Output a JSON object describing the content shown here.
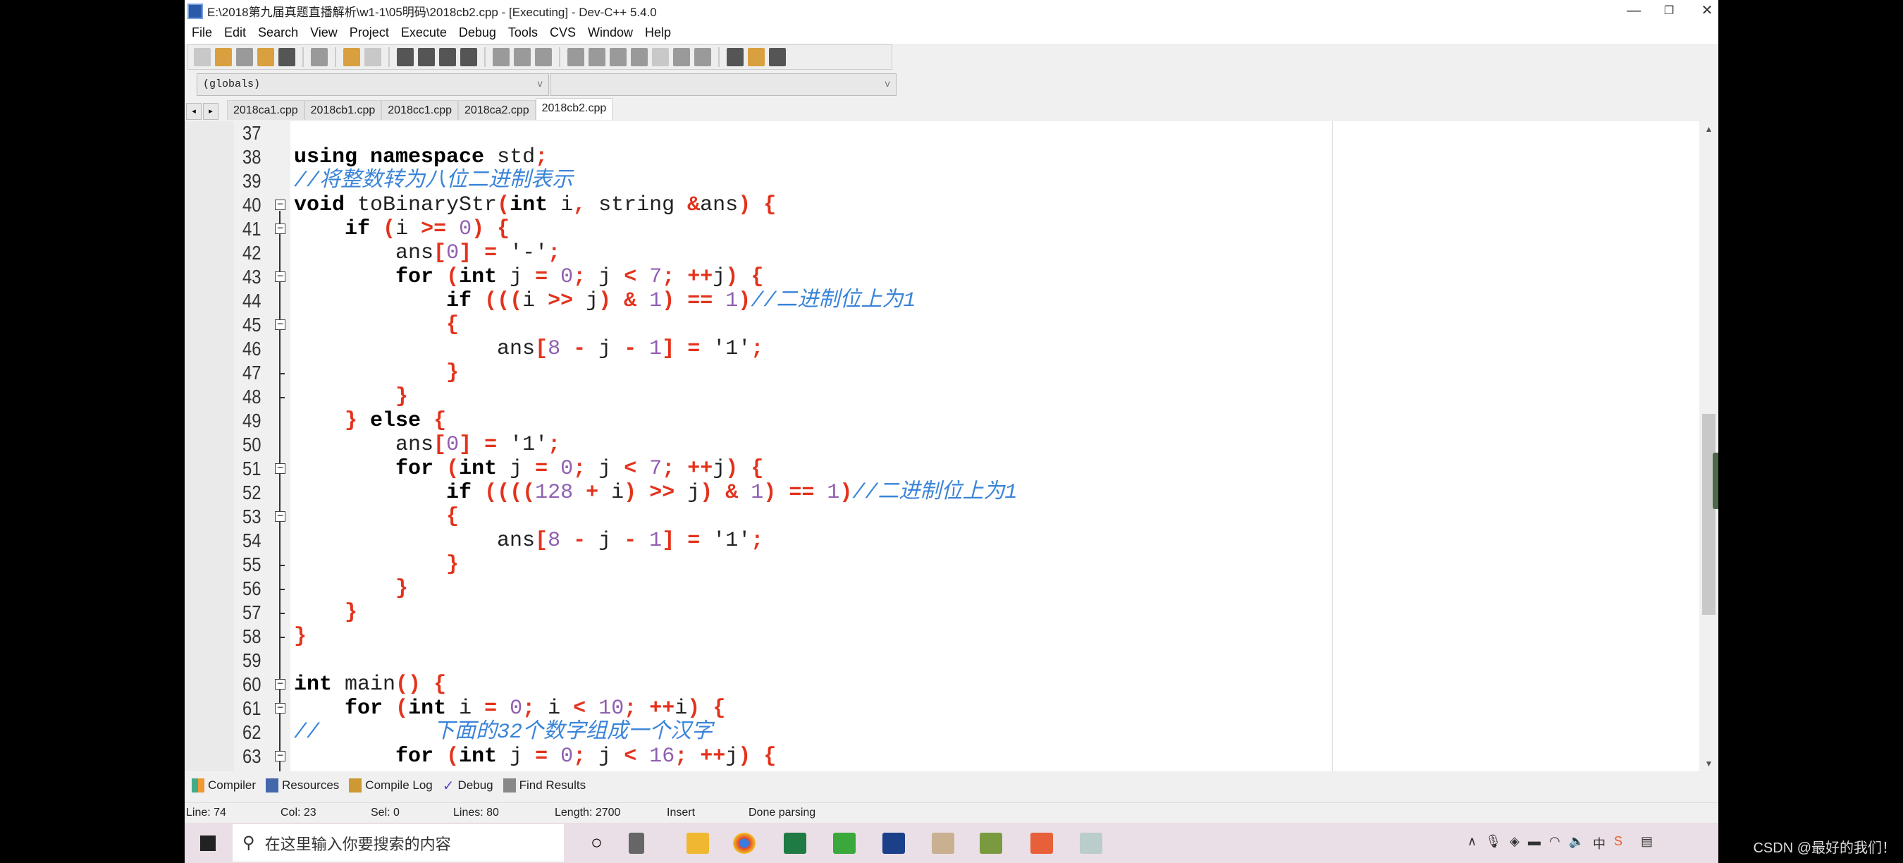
{
  "window": {
    "title": "E:\\2018第九届真题直播解析\\w1-1\\05明码\\2018cb2.cpp - [Executing] - Dev-C++ 5.4.0",
    "minimize": "—",
    "restore": "❐",
    "close": "✕"
  },
  "menu": [
    "File",
    "Edit",
    "Search",
    "View",
    "Project",
    "Execute",
    "Debug",
    "Tools",
    "CVS",
    "Window",
    "Help"
  ],
  "combos": {
    "left": "(globals)",
    "right": "",
    "arrow": "v"
  },
  "tabs": {
    "nav_prev": "◂",
    "nav_next": "▸",
    "items": [
      "2018ca1.cpp",
      "2018cb1.cpp",
      "2018cc1.cpp",
      "2018ca2.cpp",
      "2018cb2.cpp"
    ],
    "active": 4
  },
  "code": [
    {
      "n": "37",
      "fold": "",
      "t": []
    },
    {
      "n": "38",
      "fold": "",
      "t": [
        [
          "k",
          "using"
        ],
        [
          "i",
          " "
        ],
        [
          "k",
          "namespace"
        ],
        [
          "i",
          " std"
        ],
        [
          "s",
          ";"
        ]
      ]
    },
    {
      "n": "39",
      "fold": "",
      "t": [
        [
          "c",
          "//将整数转为八位二进制表示"
        ]
      ]
    },
    {
      "n": "40",
      "fold": "open",
      "t": [
        [
          "k",
          "void"
        ],
        [
          "i",
          " toBinaryStr"
        ],
        [
          "s",
          "("
        ],
        [
          "k",
          "int"
        ],
        [
          "i",
          " i"
        ],
        [
          "s",
          ","
        ],
        [
          "i",
          " string "
        ],
        [
          "s",
          "&"
        ],
        [
          "i",
          "ans"
        ],
        [
          "s",
          ")"
        ],
        [
          "i",
          " "
        ],
        [
          "s",
          "{"
        ]
      ]
    },
    {
      "n": "41",
      "fold": "open",
      "t": [
        [
          "i",
          "    "
        ],
        [
          "k",
          "if"
        ],
        [
          "i",
          " "
        ],
        [
          "s",
          "("
        ],
        [
          "i",
          "i "
        ],
        [
          "s",
          ">="
        ],
        [
          "i",
          " "
        ],
        [
          "n",
          "0"
        ],
        [
          "s",
          ")"
        ],
        [
          "i",
          " "
        ],
        [
          "s",
          "{"
        ]
      ]
    },
    {
      "n": "42",
      "fold": "",
      "t": [
        [
          "i",
          "        ans"
        ],
        [
          "s",
          "["
        ],
        [
          "n",
          "0"
        ],
        [
          "s",
          "]"
        ],
        [
          "i",
          " "
        ],
        [
          "s",
          "="
        ],
        [
          "i",
          " "
        ],
        [
          "t",
          "'-'"
        ],
        [
          "s",
          ";"
        ]
      ]
    },
    {
      "n": "43",
      "fold": "open",
      "t": [
        [
          "i",
          "        "
        ],
        [
          "k",
          "for"
        ],
        [
          "i",
          " "
        ],
        [
          "s",
          "("
        ],
        [
          "k",
          "int"
        ],
        [
          "i",
          " j "
        ],
        [
          "s",
          "="
        ],
        [
          "i",
          " "
        ],
        [
          "n",
          "0"
        ],
        [
          "s",
          ";"
        ],
        [
          "i",
          " j "
        ],
        [
          "s",
          "<"
        ],
        [
          "i",
          " "
        ],
        [
          "n",
          "7"
        ],
        [
          "s",
          ";"
        ],
        [
          "i",
          " "
        ],
        [
          "s",
          "++"
        ],
        [
          "i",
          "j"
        ],
        [
          "s",
          ")"
        ],
        [
          "i",
          " "
        ],
        [
          "s",
          "{"
        ]
      ]
    },
    {
      "n": "44",
      "fold": "",
      "t": [
        [
          "i",
          "            "
        ],
        [
          "k",
          "if"
        ],
        [
          "i",
          " "
        ],
        [
          "s",
          "((("
        ],
        [
          "i",
          "i "
        ],
        [
          "s",
          ">>"
        ],
        [
          "i",
          " j"
        ],
        [
          "s",
          ")"
        ],
        [
          "i",
          " "
        ],
        [
          "s",
          "&"
        ],
        [
          "i",
          " "
        ],
        [
          "n",
          "1"
        ],
        [
          "s",
          ")"
        ],
        [
          "i",
          " "
        ],
        [
          "s",
          "=="
        ],
        [
          "i",
          " "
        ],
        [
          "n",
          "1"
        ],
        [
          "s",
          ")"
        ],
        [
          "c",
          "//二进制位上为1"
        ]
      ]
    },
    {
      "n": "45",
      "fold": "open",
      "t": [
        [
          "i",
          "            "
        ],
        [
          "s",
          "{"
        ]
      ]
    },
    {
      "n": "46",
      "fold": "",
      "t": [
        [
          "i",
          "                ans"
        ],
        [
          "s",
          "["
        ],
        [
          "n",
          "8"
        ],
        [
          "i",
          " "
        ],
        [
          "s",
          "-"
        ],
        [
          "i",
          " j "
        ],
        [
          "s",
          "-"
        ],
        [
          "i",
          " "
        ],
        [
          "n",
          "1"
        ],
        [
          "s",
          "]"
        ],
        [
          "i",
          " "
        ],
        [
          "s",
          "="
        ],
        [
          "i",
          " "
        ],
        [
          "t",
          "'1'"
        ],
        [
          "s",
          ";"
        ]
      ]
    },
    {
      "n": "47",
      "fold": "end",
      "t": [
        [
          "i",
          "            "
        ],
        [
          "s",
          "}"
        ]
      ]
    },
    {
      "n": "48",
      "fold": "end",
      "t": [
        [
          "i",
          "        "
        ],
        [
          "s",
          "}"
        ]
      ]
    },
    {
      "n": "49",
      "fold": "",
      "t": [
        [
          "i",
          "    "
        ],
        [
          "s",
          "}"
        ],
        [
          "i",
          " "
        ],
        [
          "k",
          "else"
        ],
        [
          "i",
          " "
        ],
        [
          "s",
          "{"
        ]
      ]
    },
    {
      "n": "50",
      "fold": "",
      "t": [
        [
          "i",
          "        ans"
        ],
        [
          "s",
          "["
        ],
        [
          "n",
          "0"
        ],
        [
          "s",
          "]"
        ],
        [
          "i",
          " "
        ],
        [
          "s",
          "="
        ],
        [
          "i",
          " "
        ],
        [
          "t",
          "'1'"
        ],
        [
          "s",
          ";"
        ]
      ]
    },
    {
      "n": "51",
      "fold": "open",
      "t": [
        [
          "i",
          "        "
        ],
        [
          "k",
          "for"
        ],
        [
          "i",
          " "
        ],
        [
          "s",
          "("
        ],
        [
          "k",
          "int"
        ],
        [
          "i",
          " j "
        ],
        [
          "s",
          "="
        ],
        [
          "i",
          " "
        ],
        [
          "n",
          "0"
        ],
        [
          "s",
          ";"
        ],
        [
          "i",
          " j "
        ],
        [
          "s",
          "<"
        ],
        [
          "i",
          " "
        ],
        [
          "n",
          "7"
        ],
        [
          "s",
          ";"
        ],
        [
          "i",
          " "
        ],
        [
          "s",
          "++"
        ],
        [
          "i",
          "j"
        ],
        [
          "s",
          ")"
        ],
        [
          "i",
          " "
        ],
        [
          "s",
          "{"
        ]
      ]
    },
    {
      "n": "52",
      "fold": "",
      "t": [
        [
          "i",
          "            "
        ],
        [
          "k",
          "if"
        ],
        [
          "i",
          " "
        ],
        [
          "s",
          "(((("
        ],
        [
          "n",
          "128"
        ],
        [
          "i",
          " "
        ],
        [
          "s",
          "+"
        ],
        [
          "i",
          " i"
        ],
        [
          "s",
          ")"
        ],
        [
          "i",
          " "
        ],
        [
          "s",
          ">>"
        ],
        [
          "i",
          " j"
        ],
        [
          "s",
          ")"
        ],
        [
          "i",
          " "
        ],
        [
          "s",
          "&"
        ],
        [
          "i",
          " "
        ],
        [
          "n",
          "1"
        ],
        [
          "s",
          ")"
        ],
        [
          "i",
          " "
        ],
        [
          "s",
          "=="
        ],
        [
          "i",
          " "
        ],
        [
          "n",
          "1"
        ],
        [
          "s",
          ")"
        ],
        [
          "c",
          "//二进制位上为1"
        ]
      ]
    },
    {
      "n": "53",
      "fold": "open",
      "t": [
        [
          "i",
          "            "
        ],
        [
          "s",
          "{"
        ]
      ]
    },
    {
      "n": "54",
      "fold": "",
      "t": [
        [
          "i",
          "                ans"
        ],
        [
          "s",
          "["
        ],
        [
          "n",
          "8"
        ],
        [
          "i",
          " "
        ],
        [
          "s",
          "-"
        ],
        [
          "i",
          " j "
        ],
        [
          "s",
          "-"
        ],
        [
          "i",
          " "
        ],
        [
          "n",
          "1"
        ],
        [
          "s",
          "]"
        ],
        [
          "i",
          " "
        ],
        [
          "s",
          "="
        ],
        [
          "i",
          " "
        ],
        [
          "t",
          "'1'"
        ],
        [
          "s",
          ";"
        ]
      ]
    },
    {
      "n": "55",
      "fold": "end",
      "t": [
        [
          "i",
          "            "
        ],
        [
          "s",
          "}"
        ]
      ]
    },
    {
      "n": "56",
      "fold": "end",
      "t": [
        [
          "i",
          "        "
        ],
        [
          "s",
          "}"
        ]
      ]
    },
    {
      "n": "57",
      "fold": "end",
      "t": [
        [
          "i",
          "    "
        ],
        [
          "s",
          "}"
        ]
      ]
    },
    {
      "n": "58",
      "fold": "last",
      "t": [
        [
          "s",
          "}"
        ]
      ]
    },
    {
      "n": "59",
      "fold": "",
      "t": []
    },
    {
      "n": "60",
      "fold": "open",
      "t": [
        [
          "k",
          "int"
        ],
        [
          "i",
          " main"
        ],
        [
          "s",
          "()"
        ],
        [
          "i",
          " "
        ],
        [
          "s",
          "{"
        ]
      ]
    },
    {
      "n": "61",
      "fold": "open",
      "t": [
        [
          "i",
          "    "
        ],
        [
          "k",
          "for"
        ],
        [
          "i",
          " "
        ],
        [
          "s",
          "("
        ],
        [
          "k",
          "int"
        ],
        [
          "i",
          " i "
        ],
        [
          "s",
          "="
        ],
        [
          "i",
          " "
        ],
        [
          "n",
          "0"
        ],
        [
          "s",
          ";"
        ],
        [
          "i",
          " i "
        ],
        [
          "s",
          "<"
        ],
        [
          "i",
          " "
        ],
        [
          "n",
          "10"
        ],
        [
          "s",
          ";"
        ],
        [
          "i",
          " "
        ],
        [
          "s",
          "++"
        ],
        [
          "i",
          "i"
        ],
        [
          "s",
          ")"
        ],
        [
          "i",
          " "
        ],
        [
          "s",
          "{"
        ]
      ]
    },
    {
      "n": "62",
      "fold": "",
      "t": [
        [
          "c",
          "//         下面的32个数字组成一个汉字"
        ]
      ]
    },
    {
      "n": "63",
      "fold": "open",
      "t": [
        [
          "i",
          "        "
        ],
        [
          "k",
          "for"
        ],
        [
          "i",
          " "
        ],
        [
          "s",
          "("
        ],
        [
          "k",
          "int"
        ],
        [
          "i",
          " j "
        ],
        [
          "s",
          "="
        ],
        [
          "i",
          " "
        ],
        [
          "n",
          "0"
        ],
        [
          "s",
          ";"
        ],
        [
          "i",
          " j "
        ],
        [
          "s",
          "<"
        ],
        [
          "i",
          " "
        ],
        [
          "n",
          "16"
        ],
        [
          "s",
          ";"
        ],
        [
          "i",
          " "
        ],
        [
          "s",
          "++"
        ],
        [
          "i",
          "j"
        ],
        [
          "s",
          ")"
        ],
        [
          "i",
          " "
        ],
        [
          "s",
          "{"
        ]
      ]
    }
  ],
  "bottom_tabs": [
    "Compiler",
    "Resources",
    "Compile Log",
    "Debug",
    "Find Results"
  ],
  "status": {
    "line": "Line:   74",
    "col": "Col:   23",
    "sel": "Sel:   0",
    "lines": "Lines:   80",
    "length": "Length:  2700",
    "mode": "Insert",
    "msg": "Done parsing"
  },
  "taskbar": {
    "search_placeholder": "在这里输入你要搜索的内容",
    "tray_ime": "中"
  },
  "overlay": {
    "csdn": "CSDN @最好的我们！"
  },
  "colors": {
    "keyword": "#000000",
    "symbol": "#e3321c",
    "number": "#9060b0",
    "comment": "#3a84d8"
  }
}
